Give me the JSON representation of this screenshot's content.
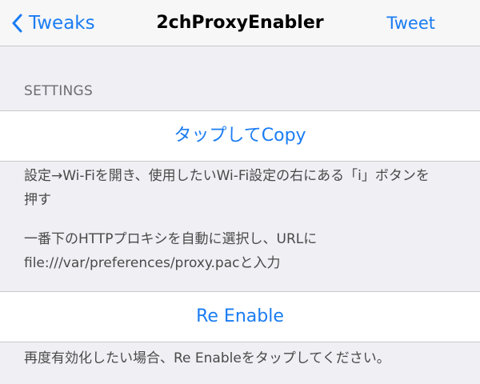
{
  "navbar": {
    "back_label": "Tweaks",
    "title": "2chProxyEnabler",
    "tweet_label": "Tweet"
  },
  "settings": {
    "header": "SETTINGS",
    "copy_button": "タップしてCopy",
    "instruction_1": "設定→Wi-Fiを開き、使用したいWi-Fi設定の右にある「i」ボタンを押す",
    "instruction_2": "一番下のHTTPプロキシを自動に選択し、URLにfile:///var/preferences/proxy.pacと入力",
    "reenable_button": "Re Enable",
    "reenable_note": "再度有効化したい場合、Re Enableをタップしてください。"
  },
  "colors": {
    "accent": "#1a7cf2",
    "background": "#efeff4"
  }
}
